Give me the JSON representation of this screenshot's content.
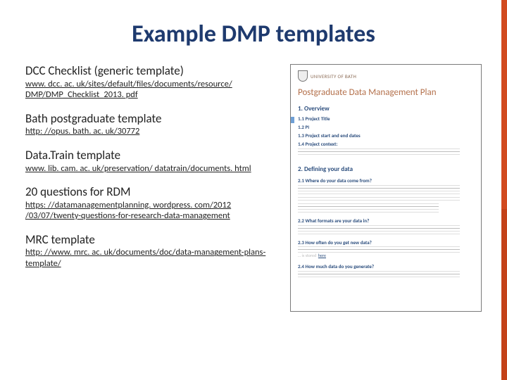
{
  "title": "Example DMP templates",
  "sections": [
    {
      "heading": "DCC Checklist (generic template)",
      "link": "www. dcc. ac. uk/sites/default/files/documents/resource/ DMP/DMP_Checklist_2013. pdf"
    },
    {
      "heading": "Bath postgraduate template",
      "link": "http: //opus. bath. ac. uk/30772"
    },
    {
      "heading": "Data.Train template",
      "link": "www. lib. cam. ac. uk/preservation/ datatrain/documents. html"
    },
    {
      "heading": "20 questions for RDM",
      "link": "https: //datamanagementplanning. wordpress. com/2012 /03/07/twenty-questions-for-research-data-management"
    },
    {
      "heading": "MRC template",
      "link": "http: //www. mrc. ac. uk/documents/doc/data-management-plans-template/"
    }
  ],
  "preview": {
    "university": "UNIVERSITY OF BATH",
    "doc_title": "Postgraduate Data Management Plan",
    "h_overview": "1. Overview",
    "i_11": "1.1 Project Title",
    "i_12": "1.2 PI",
    "i_13": "1.3 Project start and end dates",
    "i_14": "1.4 Project context:",
    "h_defining": "2. Defining your data",
    "i_21": "2.1 Where do your data come from?",
    "i_22": "2.2 What formats are your data in?",
    "i_23": "2.3 How often do you get new data?",
    "i_24": "2.4 How much data do you generate?",
    "link_word": "here"
  }
}
